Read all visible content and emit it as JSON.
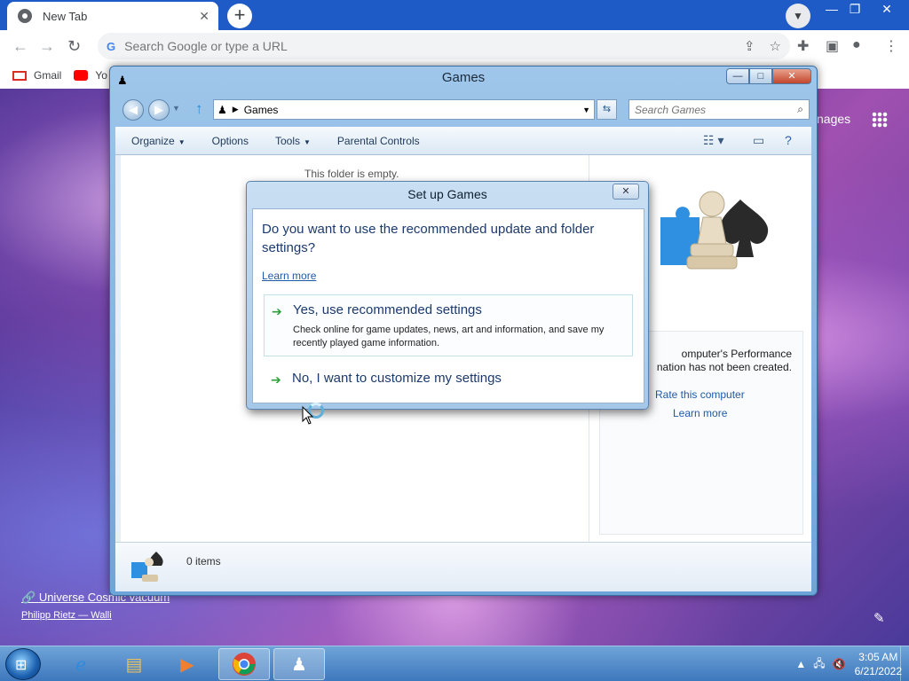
{
  "browser": {
    "tab_title": "New Tab",
    "tab_close": "✕",
    "new_tab": "+",
    "omnibox_placeholder": "Search Google or type a URL",
    "bookmarks": [
      {
        "label": "Gmail",
        "color": "#d93025"
      },
      {
        "label": "Yo",
        "color": "#ff0000"
      }
    ],
    "win_min": "—",
    "win_restore": "❐",
    "win_close": "✕"
  },
  "ntp": {
    "images_link": "nages",
    "credit_title": "Universe Cosmic vacuum",
    "credit_author": "Philipp Rietz — Walli"
  },
  "games_window": {
    "title": "Games",
    "breadcrumb": "Games",
    "search_placeholder": "Search Games",
    "commands": {
      "organize": "Organize",
      "options": "Options",
      "tools": "Tools",
      "parental": "Parental Controls"
    },
    "empty_message": "This folder is empty.",
    "performance_text_1": "omputer's Performance",
    "performance_text_2": "nation has not been created.",
    "rate_link": "Rate this computer",
    "learn_link": "Learn more",
    "status_items": "0 items",
    "caption_min": "—",
    "caption_max": "□",
    "caption_close": "✕"
  },
  "dialog": {
    "title": "Set up Games",
    "close": "✕",
    "question": "Do you want to use the recommended update and folder settings?",
    "learn_more": "Learn more",
    "option_recommended": "Yes, use recommended settings",
    "option_recommended_desc": "Check online for game updates, news, art and information, and save my recently played game information.",
    "option_customize": "No, I want to customize my settings",
    "arrow_color": "#2e9e3a"
  },
  "taskbar": {
    "time": "3:05 AM",
    "date": "6/21/2022"
  }
}
